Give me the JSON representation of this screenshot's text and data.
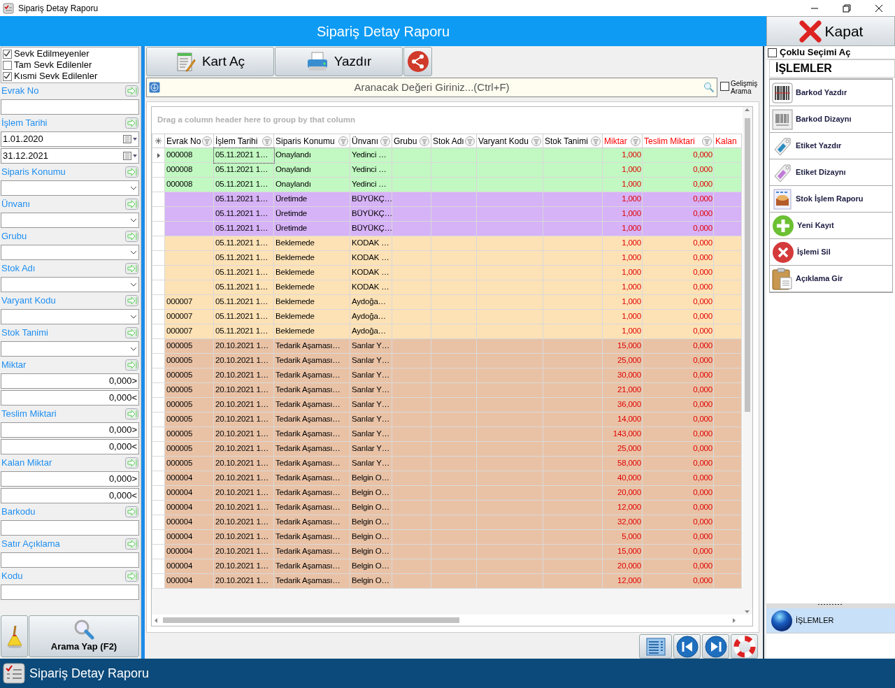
{
  "window": {
    "title": "Sipariş Detay Raporu"
  },
  "header": {
    "title": "Sipariş Detay Raporu",
    "close_button": "Kapat"
  },
  "filters": {
    "options": [
      {
        "label": "Sevk Edilmeyenler",
        "checked": true
      },
      {
        "label": "Tam Sevk Edilenler",
        "checked": false
      },
      {
        "label": "Kısmi Sevk Edilenler",
        "checked": true
      }
    ],
    "fields": [
      {
        "label": "Evrak No",
        "kind": "text"
      },
      {
        "label": "İşlem Tarihi",
        "kind": "date",
        "values": [
          "1.01.2020",
          "31.12.2021"
        ]
      },
      {
        "label": "Siparis Konumu",
        "kind": "combo"
      },
      {
        "label": "Ünvanı",
        "kind": "combo"
      },
      {
        "label": "Grubu",
        "kind": "combo"
      },
      {
        "label": "Stok Adı",
        "kind": "combo"
      },
      {
        "label": "Varyant Kodu",
        "kind": "combo"
      },
      {
        "label": "Stok Tanimi",
        "kind": "combo"
      },
      {
        "label": "Miktar",
        "kind": "range",
        "values": [
          "0,000>",
          "0,000<"
        ]
      },
      {
        "label": "Teslim Miktari",
        "kind": "range",
        "values": [
          "0,000>",
          "0,000<"
        ]
      },
      {
        "label": "Kalan Miktar",
        "kind": "range",
        "values": [
          "0,000>",
          "0,000<"
        ]
      },
      {
        "label": "Barkodu",
        "kind": "text"
      },
      {
        "label": "Satır Açıklama",
        "kind": "text"
      },
      {
        "label": "Kodu",
        "kind": "text"
      }
    ],
    "search_button": "Arama Yap (F2)"
  },
  "toolbar": {
    "buttons": [
      "Kart Aç",
      "Yazdır"
    ]
  },
  "search": {
    "placeholder": "Aranacak Değeri Giriniz...(Ctrl+F)",
    "advanced": {
      "label": "Gelişmiş Arama",
      "checked": false
    }
  },
  "grid": {
    "group_hint": "Drag a column header here to group by that column",
    "columns": [
      {
        "label": "Evrak No",
        "color": "#000000"
      },
      {
        "label": "İşlem Tarihi",
        "color": "#000000"
      },
      {
        "label": "Siparis Konumu",
        "color": "#000000"
      },
      {
        "label": "Ünvanı",
        "color": "#000000"
      },
      {
        "label": "Grubu",
        "color": "#000000"
      },
      {
        "label": "Stok Adı",
        "color": "#000000"
      },
      {
        "label": "Varyant Kodu",
        "color": "#000000"
      },
      {
        "label": "Stok Tanimi",
        "color": "#000000"
      },
      {
        "label": "Miktar",
        "color": "#ff0000"
      },
      {
        "label": "Teslim Miktari",
        "color": "#ff0000"
      },
      {
        "label": "Kalan",
        "color": "#ff0000"
      }
    ],
    "rows": [
      {
        "no": "000008",
        "date": "05.11.2021 1…",
        "status": "Onaylandı",
        "title": "Yedinci …",
        "qty": "1,000",
        "delivered": "0,000",
        "color": "#c2f8c2",
        "selected": true
      },
      {
        "no": "000008",
        "date": "05.11.2021 1…",
        "status": "Onaylandı",
        "title": "Yedinci …",
        "qty": "1,000",
        "delivered": "0,000",
        "color": "#c2f8c2",
        "selected": false
      },
      {
        "no": "000008",
        "date": "05.11.2021 1…",
        "status": "Onaylandı",
        "title": "Yedinci …",
        "qty": "1,000",
        "delivered": "0,000",
        "color": "#c2f8c2",
        "selected": false
      },
      {
        "date": "05.11.2021 1…",
        "status": "Üretimde",
        "title": "BÜYÜKÇ…",
        "qty": "1,000",
        "delivered": "0,000",
        "color": "#d6b2f7",
        "selected": false
      },
      {
        "date": "05.11.2021 1…",
        "status": "Üretimde",
        "title": "BÜYÜKÇ…",
        "qty": "1,000",
        "delivered": "0,000",
        "color": "#d6b2f7",
        "selected": false
      },
      {
        "date": "05.11.2021 1…",
        "status": "Üretimde",
        "title": "BÜYÜKÇ…",
        "qty": "1,000",
        "delivered": "0,000",
        "color": "#d6b2f7",
        "selected": false
      },
      {
        "date": "05.11.2021 1…",
        "status": "Beklemede",
        "title": "KODAK …",
        "qty": "1,000",
        "delivered": "0,000",
        "color": "#fde2b6",
        "selected": false
      },
      {
        "date": "05.11.2021 1…",
        "status": "Beklemede",
        "title": "KODAK …",
        "qty": "1,000",
        "delivered": "0,000",
        "color": "#fde2b6",
        "selected": false
      },
      {
        "date": "05.11.2021 1…",
        "status": "Beklemede",
        "title": "KODAK …",
        "qty": "1,000",
        "delivered": "0,000",
        "color": "#fde2b6",
        "selected": false
      },
      {
        "date": "05.11.2021 1…",
        "status": "Beklemede",
        "title": "KODAK …",
        "qty": "1,000",
        "delivered": "0,000",
        "color": "#fde2b6",
        "selected": false
      },
      {
        "no": "000007",
        "date": "05.11.2021 1…",
        "status": "Beklemede",
        "title": "Aydoğa…",
        "qty": "1,000",
        "delivered": "0,000",
        "color": "#fde2b6",
        "selected": false
      },
      {
        "no": "000007",
        "date": "05.11.2021 1…",
        "status": "Beklemede",
        "title": "Aydoğa…",
        "qty": "1,000",
        "delivered": "0,000",
        "color": "#fde2b6",
        "selected": false
      },
      {
        "no": "000007",
        "date": "05.11.2021 1…",
        "status": "Beklemede",
        "title": "Aydoğa…",
        "qty": "1,000",
        "delivered": "0,000",
        "color": "#fde2b6",
        "selected": false
      },
      {
        "no": "000005",
        "date": "20.10.2021 1…",
        "status": "Tedarik Aşaması…",
        "title": "Sarılar Y…",
        "qty": "15,000",
        "delivered": "0,000",
        "color": "#e9c2a6",
        "selected": false
      },
      {
        "no": "000005",
        "date": "20.10.2021 1…",
        "status": "Tedarik Aşaması…",
        "title": "Sarılar Y…",
        "qty": "25,000",
        "delivered": "0,000",
        "color": "#e9c2a6",
        "selected": false
      },
      {
        "no": "000005",
        "date": "20.10.2021 1…",
        "status": "Tedarik Aşaması…",
        "title": "Sarılar Y…",
        "qty": "30,000",
        "delivered": "0,000",
        "color": "#e9c2a6",
        "selected": false
      },
      {
        "no": "000005",
        "date": "20.10.2021 1…",
        "status": "Tedarik Aşaması…",
        "title": "Sarılar Y…",
        "qty": "21,000",
        "delivered": "0,000",
        "color": "#e9c2a6",
        "selected": false
      },
      {
        "no": "000005",
        "date": "20.10.2021 1…",
        "status": "Tedarik Aşaması…",
        "title": "Sarılar Y…",
        "qty": "36,000",
        "delivered": "0,000",
        "color": "#e9c2a6",
        "selected": false
      },
      {
        "no": "000005",
        "date": "20.10.2021 1…",
        "status": "Tedarik Aşaması…",
        "title": "Sarılar Y…",
        "qty": "14,000",
        "delivered": "0,000",
        "color": "#e9c2a6",
        "selected": false
      },
      {
        "no": "000005",
        "date": "20.10.2021 1…",
        "status": "Tedarik Aşaması…",
        "title": "Sarılar Y…",
        "qty": "143,000",
        "delivered": "0,000",
        "color": "#e9c2a6",
        "selected": false
      },
      {
        "no": "000005",
        "date": "20.10.2021 1…",
        "status": "Tedarik Aşaması…",
        "title": "Sarılar Y…",
        "qty": "25,000",
        "delivered": "0,000",
        "color": "#e9c2a6",
        "selected": false
      },
      {
        "no": "000005",
        "date": "20.10.2021 1…",
        "status": "Tedarik Aşaması…",
        "title": "Sarılar Y…",
        "qty": "58,000",
        "delivered": "0,000",
        "color": "#e9c2a6",
        "selected": false
      },
      {
        "no": "000004",
        "date": "20.10.2021 1…",
        "status": "Tedarik Aşaması…",
        "title": "Belgin O…",
        "qty": "40,000",
        "delivered": "0,000",
        "color": "#e9c2a6",
        "selected": false
      },
      {
        "no": "000004",
        "date": "20.10.2021 1…",
        "status": "Tedarik Aşaması…",
        "title": "Belgin O…",
        "qty": "20,000",
        "delivered": "0,000",
        "color": "#e9c2a6",
        "selected": false
      },
      {
        "no": "000004",
        "date": "20.10.2021 1…",
        "status": "Tedarik Aşaması…",
        "title": "Belgin O…",
        "qty": "12,000",
        "delivered": "0,000",
        "color": "#e9c2a6",
        "selected": false
      },
      {
        "no": "000004",
        "date": "20.10.2021 1…",
        "status": "Tedarik Aşaması…",
        "title": "Belgin O…",
        "qty": "32,000",
        "delivered": "0,000",
        "color": "#e9c2a6",
        "selected": false
      },
      {
        "no": "000004",
        "date": "20.10.2021 1…",
        "status": "Tedarik Aşaması…",
        "title": "Belgin O…",
        "qty": "5,000",
        "delivered": "0,000",
        "color": "#e9c2a6",
        "selected": false
      },
      {
        "no": "000004",
        "date": "20.10.2021 1…",
        "status": "Tedarik Aşaması…",
        "title": "Belgin O…",
        "qty": "15,000",
        "delivered": "0,000",
        "color": "#e9c2a6",
        "selected": false
      },
      {
        "no": "000004",
        "date": "20.10.2021 1…",
        "status": "Tedarik Aşaması…",
        "title": "Belgin O…",
        "qty": "20,000",
        "delivered": "0,000",
        "color": "#e9c2a6",
        "selected": false
      },
      {
        "no": "000004",
        "date": "20.10.2021 1…",
        "status": "Tedarik Aşaması…",
        "title": "Belgin O…",
        "qty": "12,000",
        "delivered": "0,000",
        "color": "#e9c2a6",
        "selected": false
      }
    ]
  },
  "actions": {
    "multi_select": {
      "label": "Çoklu Seçimi Aç",
      "checked": false
    },
    "title": "İŞLEMLER",
    "items": [
      "Barkod Yazdır",
      "Barkod Dizaynı",
      "Etiket Yazdır",
      "Etiket Dizaynı",
      "Stok İşlem Raporu",
      "Yeni Kayıt",
      "İşlemi Sil",
      "Açıklama Gir"
    ]
  },
  "nav_group": {
    "label": "İŞLEMLER",
    "selected": true
  },
  "status_bar": {
    "title": "Sipariş Detay Raporu"
  }
}
